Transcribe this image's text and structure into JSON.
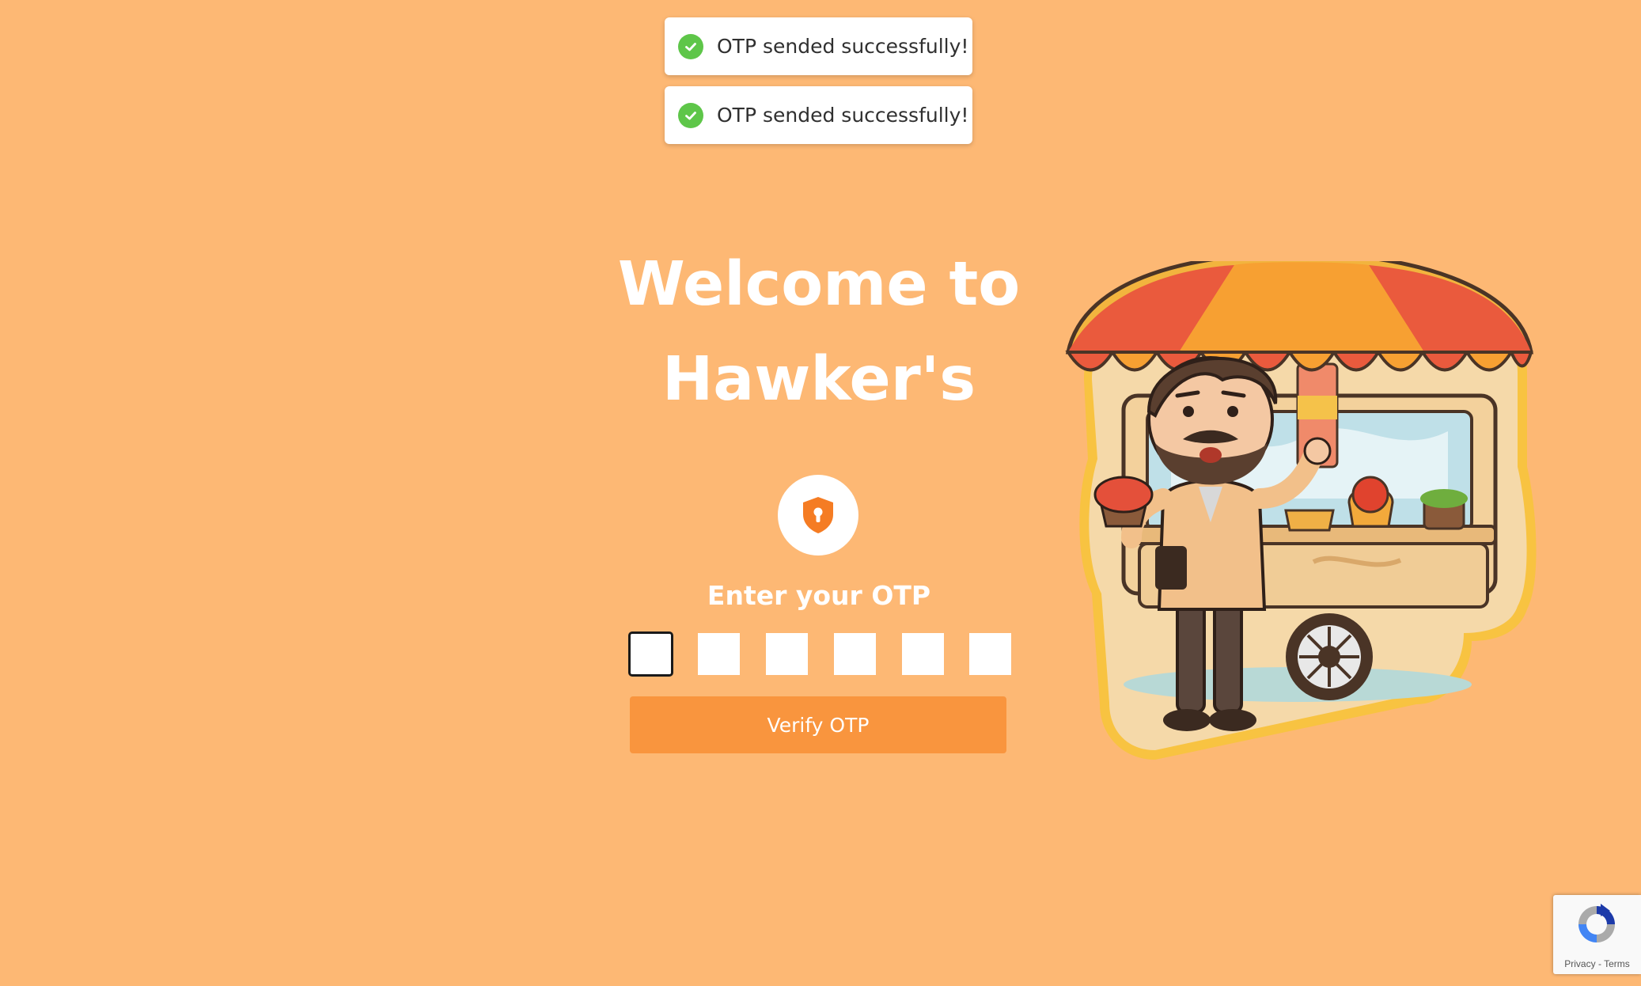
{
  "toasts": [
    {
      "text": "OTP sended successfully!",
      "icon": "check-circle-icon",
      "color": "#5ec649"
    },
    {
      "text": "OTP sended successfully!",
      "icon": "check-circle-icon",
      "color": "#5ec649"
    }
  ],
  "hero": {
    "title_line1": "Welcome to",
    "title_line2": "Hawker's"
  },
  "form": {
    "icon": "shield-lock-icon",
    "label": "Enter your OTP",
    "otp_digits": [
      "",
      "",
      "",
      "",
      "",
      ""
    ],
    "verify_label": "Verify OTP"
  },
  "recaptcha": {
    "privacy": "Privacy",
    "separator": " - ",
    "terms": "Terms"
  },
  "colors": {
    "background": "#fdb874",
    "button": "#f9953e",
    "accent": "#f57c23",
    "success": "#5ec649"
  }
}
